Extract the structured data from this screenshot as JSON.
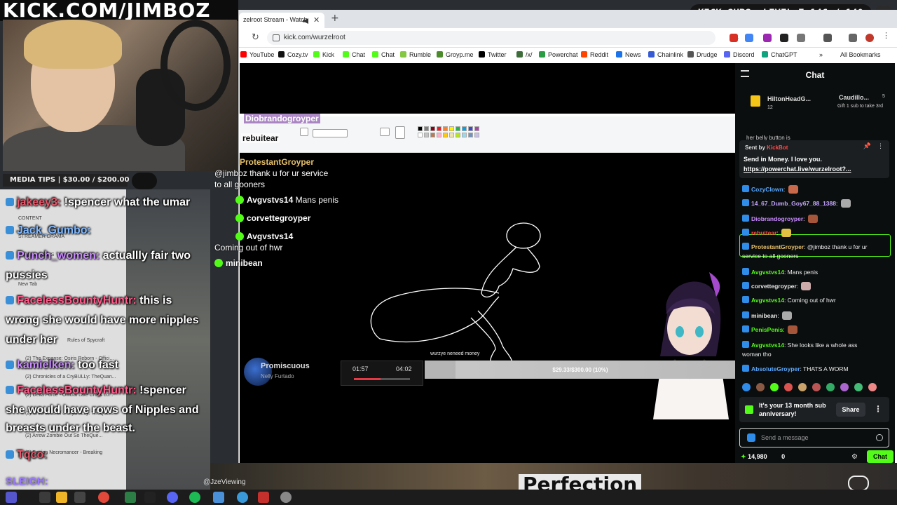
{
  "overlay": {
    "title": "KICK.COM/JIMBOZ",
    "subs_badge": "KICK SUBS: LEVEL 7 146 / 140",
    "media_tips": "MEDIA TIPS | $30.00 / $200.00",
    "sleigh": "SLEIGH:",
    "perfection": "Perfection",
    "viewer_tag": "@JzeViewing"
  },
  "overlay_chat": [
    {
      "name": "jakeey3:",
      "text": " !spencer what the umar"
    },
    {
      "name": "Jack_Gumbo:",
      "text": ""
    },
    {
      "name": "Punch_women:",
      "text": " actuallly fair two"
    },
    {
      "name": "",
      "text": "pussies"
    },
    {
      "name": "FacelessBountyHuntr:",
      "text": " this is"
    },
    {
      "name": "",
      "text": "wrong she would have more nipples"
    },
    {
      "name": "",
      "text": "under her"
    },
    {
      "name": "kamielken:",
      "text": " too fast"
    },
    {
      "name": "FacelessBountyHuntr:",
      "text": " !spencer"
    },
    {
      "name": "",
      "text": "she would have rows of Nipples and"
    },
    {
      "name": "",
      "text": "breasts under the beast."
    },
    {
      "name": "Tqco:",
      "text": ""
    }
  ],
  "explorer": {
    "items": [
      "CONTENT",
      "STREAMER DRAMA",
      "GAMING NEWS",
      "New Tab",
      "Rules of Spycraft",
      "(2) The Expanse: Osiris Reborn - Offici...",
      "(2) Chronicles of a CryBULLy: TheQuan...",
      "(2) Delta Force - Official Late Cross Lo...",
      "(2) Chronicles of a CryBULLy: TheQuer...",
      "(2) Arrow Zombie Out So TheQue...",
      "(2) Benign Necromancer - Breaking"
    ]
  },
  "browser": {
    "tab_title": "zelroot Stream - Watch",
    "url": "kick.com/wurzelroot",
    "bookmarks": [
      "YouTube",
      "Cozy.tv",
      "Kick",
      "Chat",
      "Chat",
      "Rumble",
      "Groyp.me",
      "Twitter",
      "/x/",
      "Powerchat",
      "Reddit",
      "News",
      "Chainlink",
      "Drudge",
      "Discord",
      "ChatGPT"
    ],
    "all_bookmarks": "All Bookmarks"
  },
  "stream": {
    "paint_chat": [
      {
        "name": "Diobrandogroyper",
        "text": ""
      },
      {
        "name": "rebuitear",
        "text": ""
      },
      {
        "name": "ProtestantGroyper",
        "text": ""
      },
      {
        "name": "",
        "text": "@jimboz thank u for ur service"
      },
      {
        "name": "",
        "text": "to all gooners"
      },
      {
        "name": "Avgvstvs14",
        "text": "Mans penis"
      },
      {
        "name": "corvettegroyper",
        "text": ""
      },
      {
        "name": "Avgvstvs14",
        "text": ""
      },
      {
        "name": "",
        "text": "Coming out of hwr"
      },
      {
        "name": "minibean",
        "text": ""
      }
    ],
    "music": {
      "title": "Promiscuous",
      "artist": "Nelly Furtado",
      "elapsed": "01:57",
      "total": "04:02",
      "progress": 0.48
    },
    "goal": {
      "label": "$29.33/$300.00 (10%)",
      "note": "wurzye neneed money",
      "progress": 0.1
    }
  },
  "chat": {
    "title": "Chat",
    "gifters": [
      {
        "name": "HiltonHeadG...",
        "count": "12"
      },
      {
        "name": "Caudillo...",
        "count": "5"
      }
    ],
    "gift_note": "Gift 1 sub to take 3rd",
    "prev_line": "her belly button is",
    "pinned": {
      "sent_by": "Sent by",
      "sender": "KickBot",
      "message": "Send in Money. I love you.",
      "link": "https://powerchat.live/wurzelroot?..."
    },
    "messages": [
      {
        "user": "CozyClown",
        "text": "",
        "color": "#5aa9ff"
      },
      {
        "user": "14_67_Dumb_Goy67_88_1388",
        "text": "",
        "color": "#c6a8ff"
      },
      {
        "user": "Diobrandogroyper",
        "text": "",
        "color": "#c98bff"
      },
      {
        "user": "rebuitear",
        "text": "",
        "color": "#ff4a4a"
      },
      {
        "user": "ProtestantGroyper",
        "text": "@jimboz thank u for ur",
        "color": "#e7c06a"
      },
      {
        "user": "",
        "text": "service to all gooners",
        "color": "#eee"
      },
      {
        "user": "Avgvstvs14",
        "text": "Mans penis",
        "color": "#53fc18"
      },
      {
        "user": "corvettegroyper",
        "text": "",
        "color": "#e8e8e8"
      },
      {
        "user": "Avgvstvs14",
        "text": "Coming out of hwr",
        "color": "#53fc18"
      },
      {
        "user": "minibean",
        "text": "",
        "color": "#e8e8e8"
      },
      {
        "user": "PenisPenis",
        "text": "",
        "color": "#53fc18"
      },
      {
        "user": "Avgvstvs14",
        "text": "She looks like a whole ass",
        "color": "#53fc18"
      },
      {
        "user": "",
        "text": "woman tho",
        "color": "#eee"
      },
      {
        "user": "AbsoluteGroyper",
        "text": "THATS A WORM",
        "color": "#5aa9ff"
      }
    ],
    "anniversary": "It's your 13 month sub anniversary!",
    "share": "Share",
    "input_placeholder": "Send a message",
    "points": "14,980",
    "count": "0",
    "send": "Chat"
  }
}
